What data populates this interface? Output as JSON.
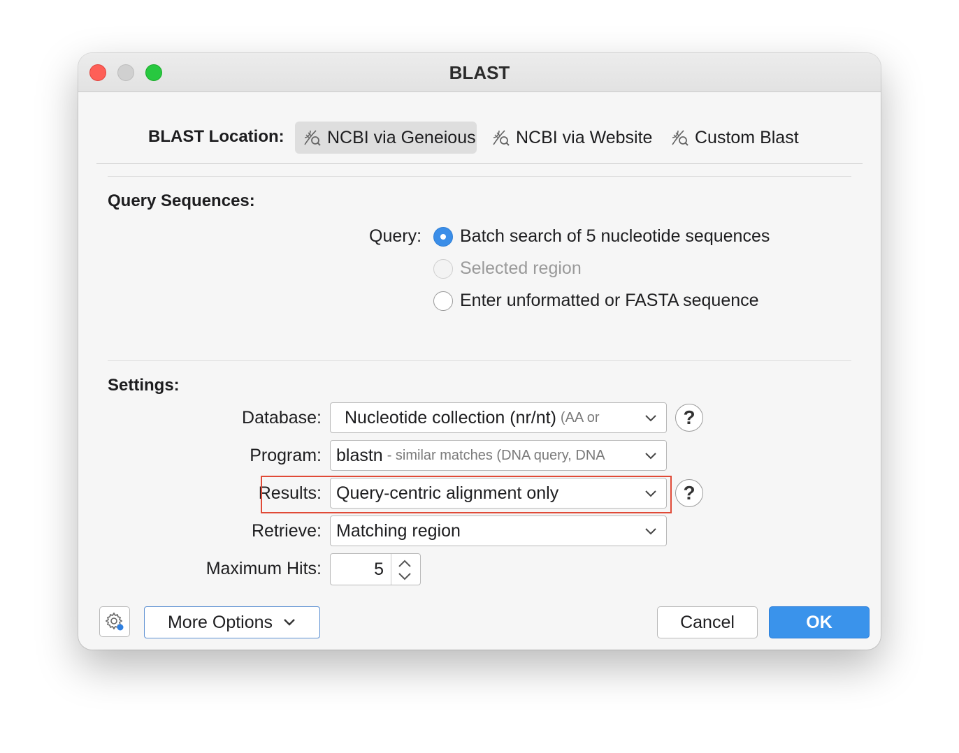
{
  "window": {
    "title": "BLAST"
  },
  "location": {
    "label": "BLAST Location:",
    "options": [
      {
        "label": "NCBI via Geneious",
        "icon": "dna-search-icon",
        "active": true
      },
      {
        "label": "NCBI via Website",
        "icon": "dna-search-icon",
        "active": false
      },
      {
        "label": "Custom Blast",
        "icon": "dna-search-icon",
        "active": false
      }
    ]
  },
  "query": {
    "section_title": "Query Sequences:",
    "label": "Query:",
    "options": [
      {
        "label": "Batch search of 5 nucleotide sequences",
        "checked": true,
        "enabled": true
      },
      {
        "label": "Selected region",
        "checked": false,
        "enabled": false
      },
      {
        "label": "Enter unformatted or FASTA sequence",
        "checked": false,
        "enabled": true
      }
    ]
  },
  "settings": {
    "section_title": "Settings:",
    "database": {
      "label": "Database:",
      "value": "Nucleotide collection (nr/nt)",
      "hint": "(AA or"
    },
    "program": {
      "label": "Program:",
      "value": "blastn",
      "hint": "- similar matches (DNA query, DNA"
    },
    "results": {
      "label": "Results:",
      "value": "Query-centric alignment only"
    },
    "retrieve": {
      "label": "Retrieve:",
      "value": "Matching region"
    },
    "max_hits": {
      "label": "Maximum Hits:",
      "value": "5"
    },
    "help_glyph": "?"
  },
  "footer": {
    "more_options": "More Options",
    "cancel": "Cancel",
    "ok": "OK"
  },
  "colors": {
    "accent": "#3a93eb",
    "highlight_box": "#e04a37",
    "close": "#fe5f57",
    "maximize": "#28c840"
  }
}
